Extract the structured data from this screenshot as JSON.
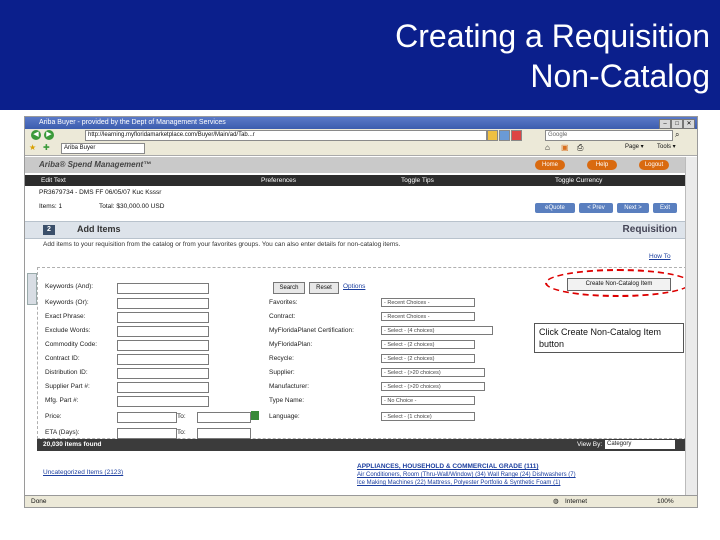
{
  "slide": {
    "title_line1": "Creating a Requisition",
    "title_line2": "Non-Catalog"
  },
  "browser": {
    "window_title": "Ariba Buyer - provided by the Dept of Management Services",
    "address": "http://learning.myfloridamarketplace.com/Buyer/Main/ad/Tab...r",
    "search_placeholder": "Google",
    "tab_label": "Ariba Buyer",
    "status_left": "Done",
    "status_right": "Internet",
    "zoom": "100%"
  },
  "ariba": {
    "logo": "Ariba® Spend Management™",
    "buttons": [
      "Home",
      "Help",
      "Logout"
    ],
    "menu": [
      "Edit Text",
      "Preferences",
      "Toggle Tips",
      "Toggle Currency"
    ],
    "req_id": "PR3679734 - DMS FF 06/05/07 Kuc Ksssr",
    "items_label": "Items: 1",
    "total_label": "Total: $30,000.00 USD",
    "top_buttons": [
      "eQuote",
      "< Prev",
      "Next >",
      "Exit"
    ]
  },
  "section": {
    "step": "2",
    "title": "Add Items",
    "right_label": "Requisition",
    "instruction": "Add items to your requisition from the catalog or from your favorites groups. You can also enter details for non-catalog items.",
    "howto": "How To"
  },
  "form": {
    "left_labels": [
      "Keywords (And):",
      "Keywords (Or):",
      "Exact Phrase:",
      "Exclude Words:",
      "Commodity Code:",
      "Contract ID:",
      "Distribution ID:",
      "Supplier Part #:",
      "Mfg. Part #:",
      "Price:",
      "ETA (Days):"
    ],
    "to_label": "To:",
    "right_labels": [
      "Favorites:",
      "Contract:",
      "MyFloridaPlanet Certification:",
      "MyFloridaPlan:",
      "Recycle:",
      "Supplier:",
      "Manufacturer:",
      "Type Name:",
      "Language:"
    ],
    "select_values": [
      "- Recent Choices -",
      "- Recent Choices -",
      "- Select - (4 choices)",
      "- Select - (2 choices)",
      "- Select - (2 choices)",
      "- Select - (>20 choices)",
      "- Select - (>20 choices)",
      "- No Choice -",
      "- Select - (1 choice)"
    ],
    "search_btn": "Search",
    "reset_btn": "Reset",
    "options_link": "Options",
    "create_btn": "Create Non-Catalog Item"
  },
  "callout": "Click Create Non-Catalog Item button",
  "results": {
    "count": "20,030 items found",
    "viewby_label": "View By:",
    "viewby_value": "Category",
    "uncategorized": "Uncategorized Items (2123)",
    "cat_title": "APPLIANCES, HOUSEHOLD & COMMERCIAL GRADE (111)",
    "cat_line1": "Air Conditioners, Room (Thru-Wall/Window) (34)   Wall Range (24)   Dishwashers (7)",
    "cat_line2": "Ice Making Machines (22)   Mattress, Polyester Portfolio & Synthetic Foam (1)"
  }
}
